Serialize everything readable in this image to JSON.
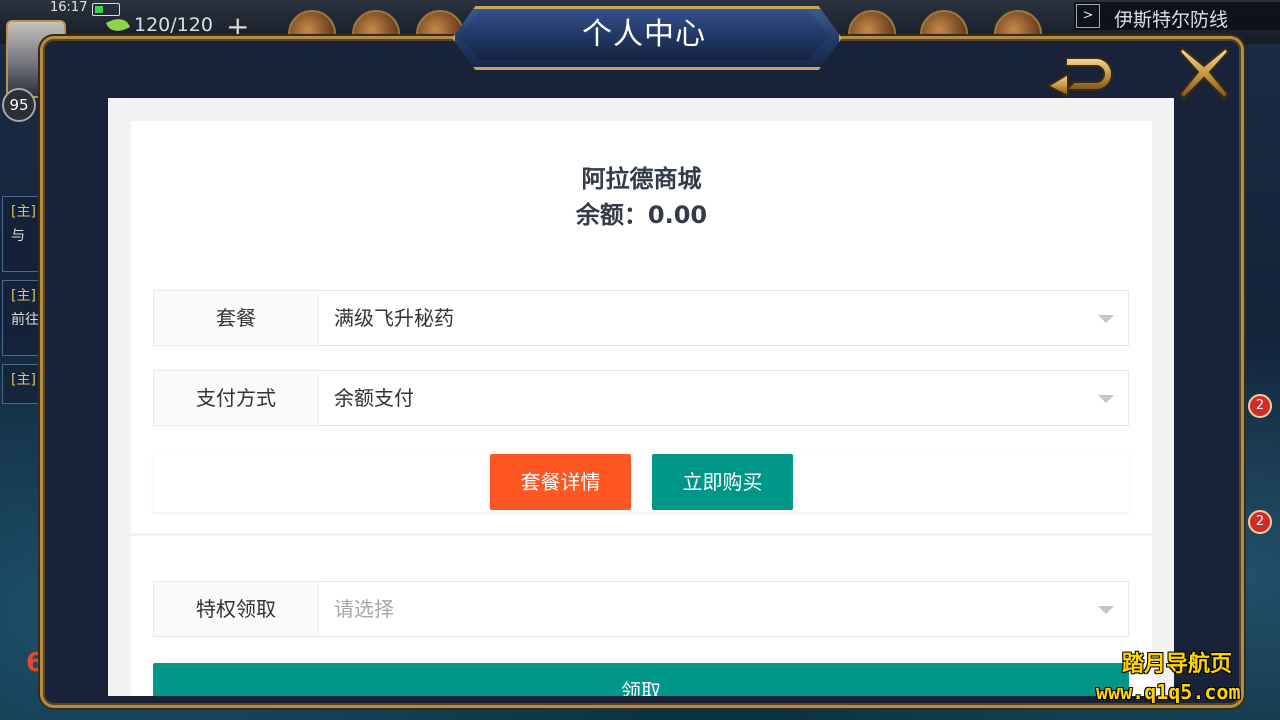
{
  "status_bar": {
    "time": "16:17"
  },
  "hud": {
    "energy": "120/120",
    "plus": "+",
    "level": "95",
    "location": "伊斯特尔防线",
    "location_play": ">",
    "quests": [
      {
        "tag": "[主]",
        "text": "与"
      },
      {
        "tag": "[主]",
        "text": "前往"
      },
      {
        "tag": "[主]",
        "text": ""
      }
    ],
    "notif_count": "2",
    "left_number": "6"
  },
  "modal": {
    "title": "个人中心"
  },
  "shop": {
    "name": "阿拉德商城",
    "balance": "余额：0.00",
    "package": {
      "label": "套餐",
      "value": "满级飞升秘药"
    },
    "payment": {
      "label": "支付方式",
      "value": "余额支付"
    },
    "details_button": "套餐详情",
    "buy_button": "立即购买",
    "privilege": {
      "label": "特权领取",
      "placeholder": "请选择"
    },
    "claim_button": "领取"
  },
  "watermark": {
    "line1": "踏月导航页",
    "line2": "www.q1q5.com"
  },
  "colors": {
    "orange": "#ff5722",
    "teal": "#009688",
    "frame_gold": "#b08d4a"
  }
}
